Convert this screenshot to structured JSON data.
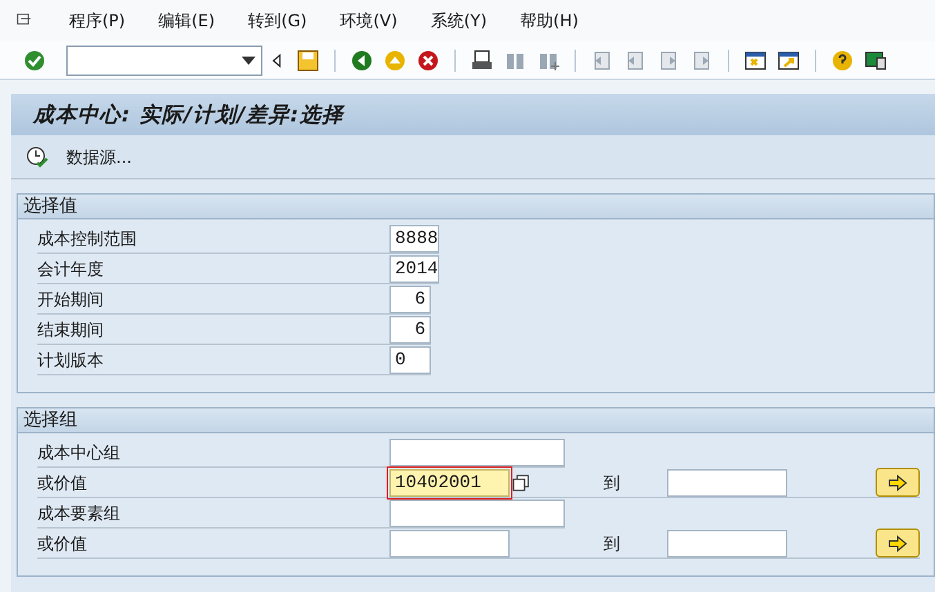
{
  "menu": [
    {
      "label": "程序(P)"
    },
    {
      "label": "编辑(E)"
    },
    {
      "label": "转到(G)"
    },
    {
      "label": "环境(V)"
    },
    {
      "label": "系统(Y)"
    },
    {
      "label": "帮助(H)"
    }
  ],
  "title": "成本中心: 实际/计划/差异:选择",
  "app_toolbar": {
    "button": "数据源..."
  },
  "sections": [
    {
      "title": "选择值",
      "rows": [
        {
          "kind": "text",
          "label": "成本控制范围",
          "value": "8888"
        },
        {
          "kind": "text",
          "label": "会计年度",
          "value": "2014"
        },
        {
          "kind": "number",
          "label": "开始期间",
          "value": "6"
        },
        {
          "kind": "number",
          "label": "结束期间",
          "value": "6"
        },
        {
          "kind": "text",
          "label": "计划版本",
          "value": "0"
        }
      ]
    },
    {
      "title": "选择组",
      "rows": [
        {
          "kind": "group",
          "label": "成本中心组"
        },
        {
          "kind": "range",
          "label": "或价值",
          "value": "10402001",
          "focused": true,
          "to_label": "到"
        },
        {
          "kind": "group",
          "label": "成本要素组"
        },
        {
          "kind": "range",
          "label": "或价值",
          "focused": false,
          "to_label": "到"
        }
      ]
    }
  ]
}
